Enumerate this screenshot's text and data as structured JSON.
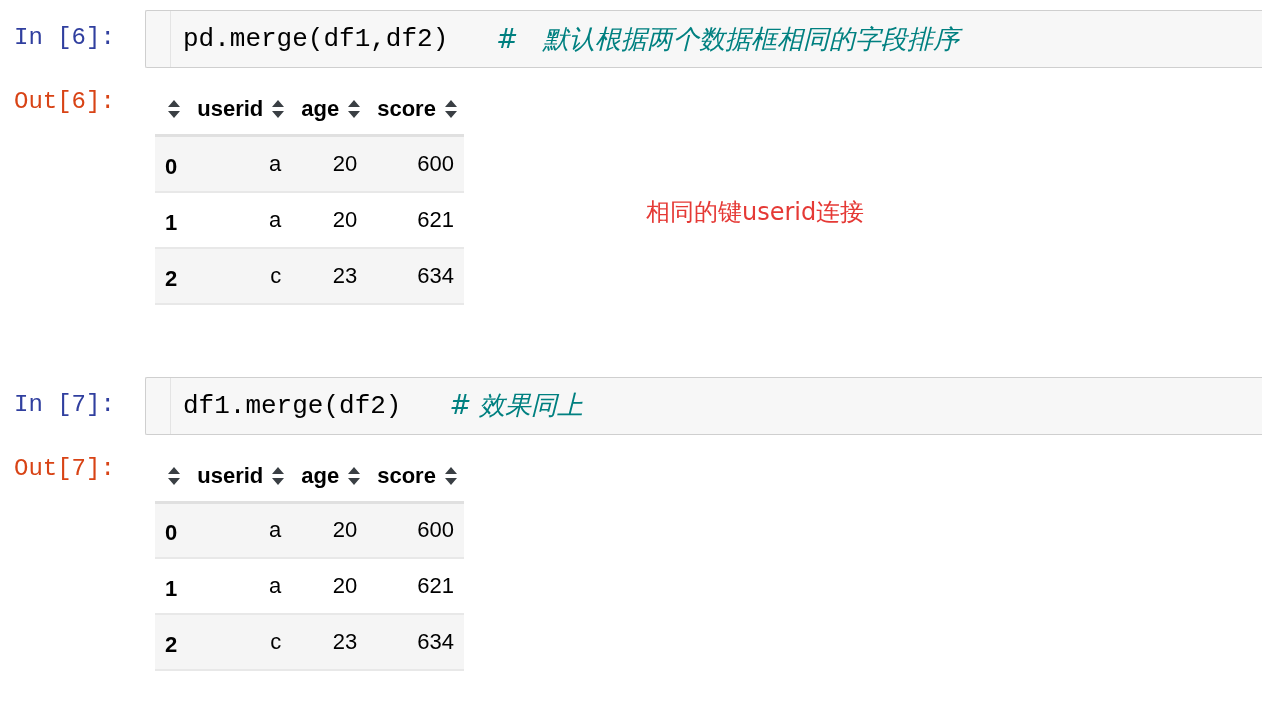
{
  "cells": [
    {
      "prompt_in": "In [6]:",
      "code": "pd.merge(df1,df2)",
      "comment": "#   默认根据两个数据框相同的字段排序",
      "prompt_out": "Out[6]:",
      "table": {
        "columns": [
          "userid",
          "age",
          "score"
        ],
        "rows": [
          {
            "index": "0",
            "values": [
              "a",
              "20",
              "600"
            ]
          },
          {
            "index": "1",
            "values": [
              "a",
              "20",
              "621"
            ]
          },
          {
            "index": "2",
            "values": [
              "c",
              "23",
              "634"
            ]
          }
        ]
      },
      "note": "相同的键userid连接"
    },
    {
      "prompt_in": "In [7]:",
      "code": "df1.merge(df2)",
      "comment": "# 效果同上",
      "prompt_out": "Out[7]:",
      "table": {
        "columns": [
          "userid",
          "age",
          "score"
        ],
        "rows": [
          {
            "index": "0",
            "values": [
              "a",
              "20",
              "600"
            ]
          },
          {
            "index": "1",
            "values": [
              "a",
              "20",
              "621"
            ]
          },
          {
            "index": "2",
            "values": [
              "c",
              "23",
              "634"
            ]
          }
        ]
      }
    }
  ]
}
